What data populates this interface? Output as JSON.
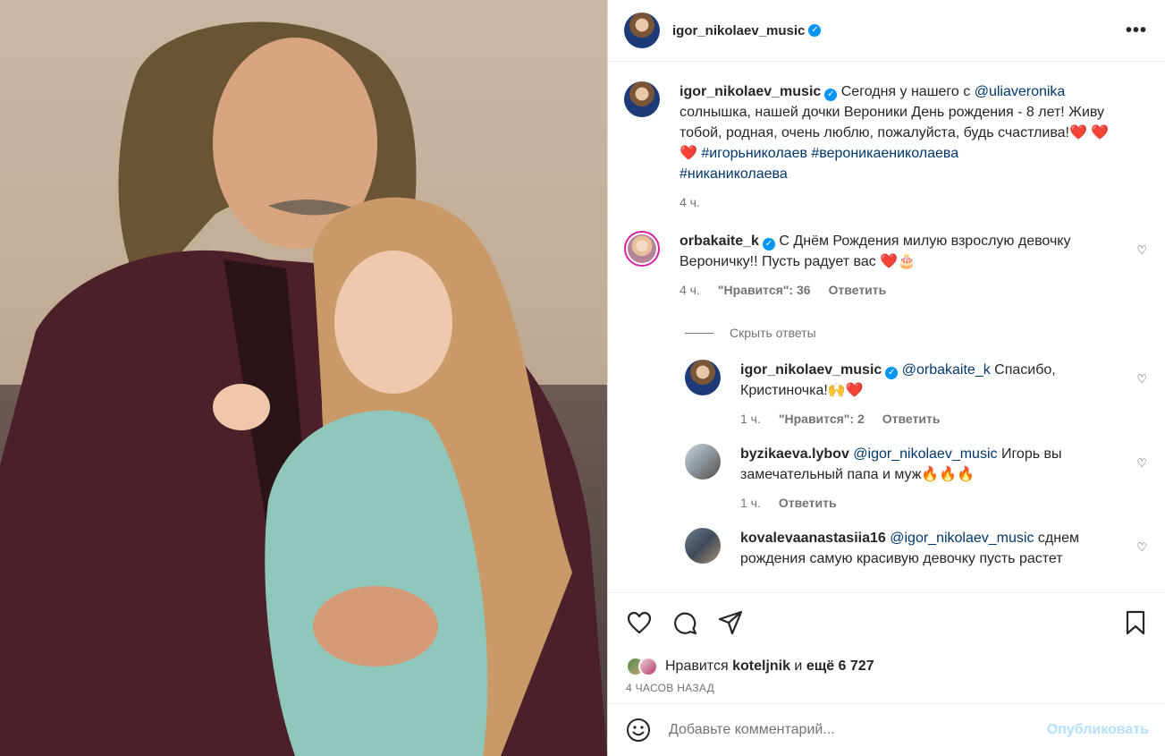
{
  "post": {
    "author": "igor_nikolaev_music",
    "more_icon": "more-horizontal-icon"
  },
  "caption": {
    "username": "igor_nikolaev_music",
    "text_before": "Сегодня у нашего с ",
    "mention": "@uliaveronika",
    "text_after": " солнышка, нашей дочки Вероники День рождения - 8 лет! Живу тобой, родная, очень люблю, пожалуйста, будь счастлива!",
    "emoji": "❤️ ❤️ ❤️ ",
    "hashtags": "#игорьниколаев #вероникаениколаева",
    "hashtag_line2": "#никаниколаева",
    "time": "4 ч."
  },
  "comments": [
    {
      "username": "orbakaite_k",
      "text": "С Днём Рождения милую взрослую девочку Вероничку!! Пусть радует вас ❤️🎂",
      "time": "4 ч.",
      "likes": "\"Нравится\": 36",
      "reply_label": "Ответить"
    }
  ],
  "hide_replies": "Скрыть ответы",
  "replies": [
    {
      "username": "igor_nikolaev_music",
      "mention": "@orbakaite_k",
      "text": " Спасибо, Кристиночка!🙌❤️",
      "time": "1 ч.",
      "likes": "\"Нравится\": 2",
      "reply_label": "Ответить"
    },
    {
      "username": "byzikaeva.lybov",
      "mention": "@igor_nikolaev_music",
      "text": " Игорь вы замечательный папа и муж🔥🔥🔥",
      "time": "1 ч.",
      "reply_label": "Ответить"
    },
    {
      "username": "kovalevaanastasiia16",
      "mention": "@igor_nikolaev_music",
      "text": " сднем рождения самую красивую девочку пусть растет",
      "time": "",
      "reply_label": ""
    }
  ],
  "likes": {
    "prefix": "Нравится",
    "user": "koteljnik",
    "and": "и",
    "count": "ещё 6 727"
  },
  "post_time": "4 ЧАСОВ НАЗАД",
  "add_comment": {
    "placeholder": "Добавьте комментарий...",
    "publish": "Опубликовать"
  },
  "colors": {
    "verified": "#0095f6",
    "link": "#00376b",
    "publish_disabled": "#b2dffc"
  }
}
